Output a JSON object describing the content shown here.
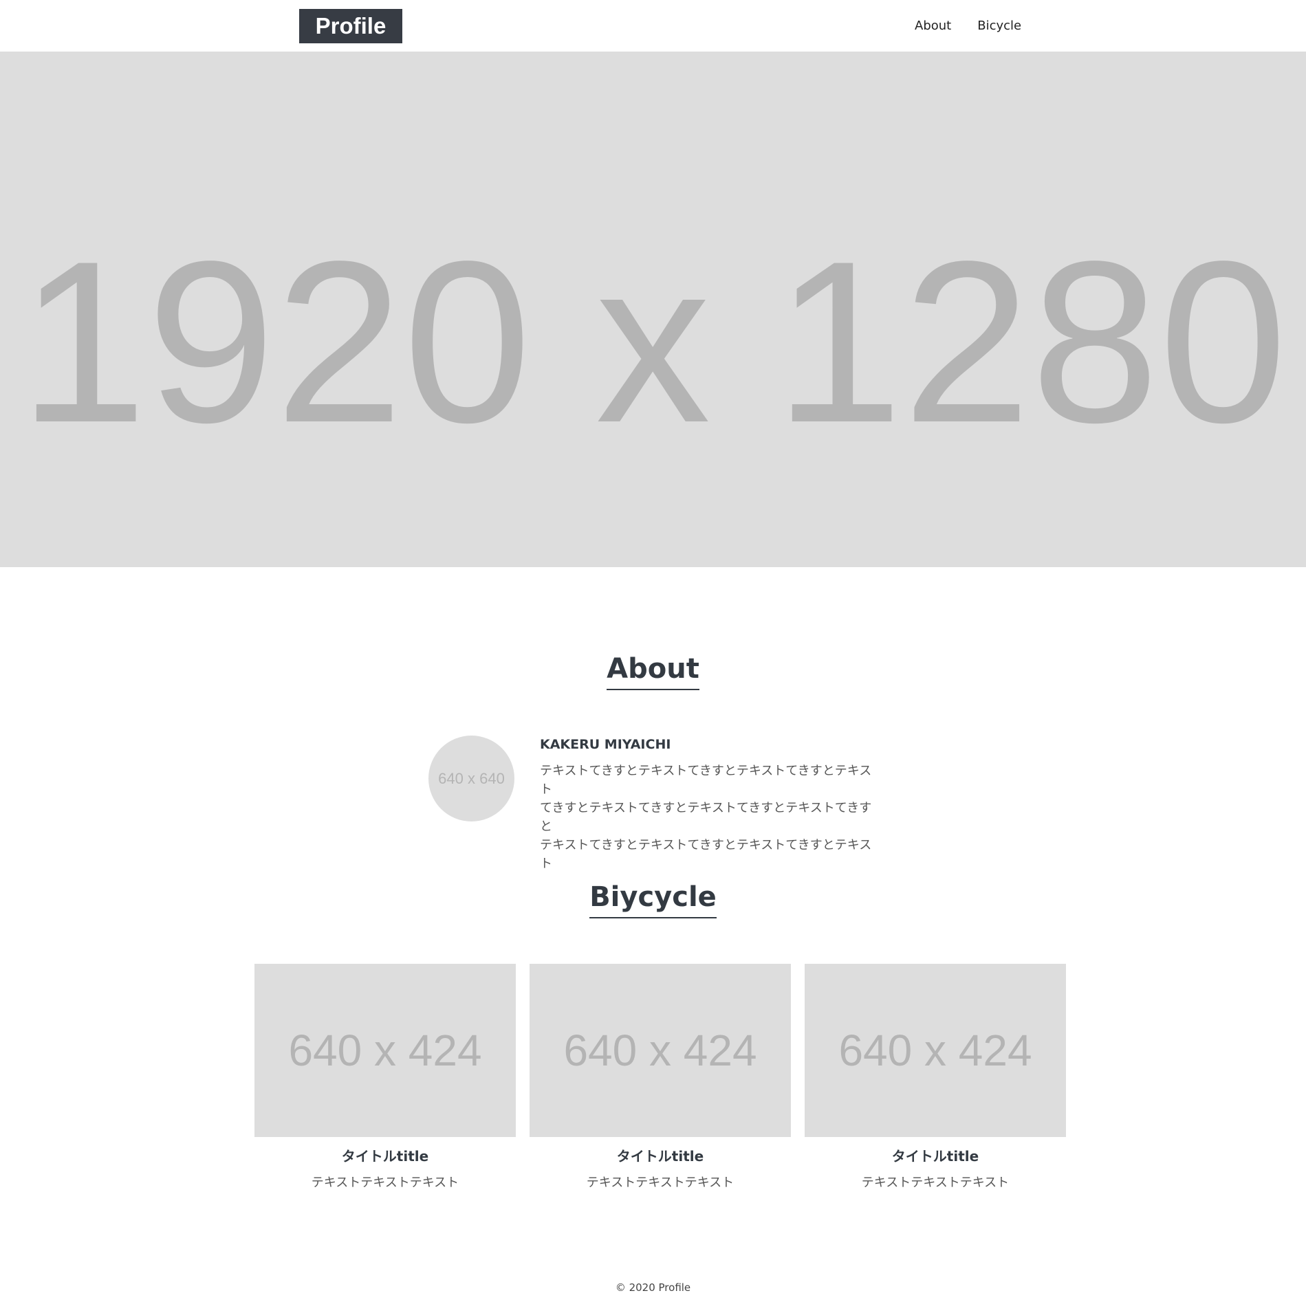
{
  "header": {
    "logo": "Profile",
    "nav": [
      {
        "label": "About"
      },
      {
        "label": "Bicycle"
      }
    ]
  },
  "hero": {
    "placeholder": "1920 x 1280"
  },
  "about": {
    "title": "About",
    "avatar_placeholder": "640 x 640",
    "name": "KAKERU MIYAICHI",
    "lines": [
      "テキストてきすとテキストてきすとテキストてきすとテキスト",
      "てきすとテキストてきすとテキストてきすとテキストてきすと",
      "テキストてきすとテキストてきすとテキストてきすとテキスト"
    ]
  },
  "bicycle": {
    "title": "Biycycle",
    "cards": [
      {
        "image_placeholder": "640 x 424",
        "title": "タイトルtitle",
        "text": "テキストテキストテキスト"
      },
      {
        "image_placeholder": "640 x 424",
        "title": "タイトルtitle",
        "text": "テキストテキストテキスト"
      },
      {
        "image_placeholder": "640 x 424",
        "title": "タイトルtitle",
        "text": "テキストテキストテキスト"
      }
    ]
  },
  "footer": {
    "copyright": "© 2020 Profile"
  },
  "colors": {
    "logo_bg": "#373c44",
    "placeholder_bg": "#dddddd",
    "placeholder_text": "#b4b4b4",
    "heading": "#333a42"
  }
}
